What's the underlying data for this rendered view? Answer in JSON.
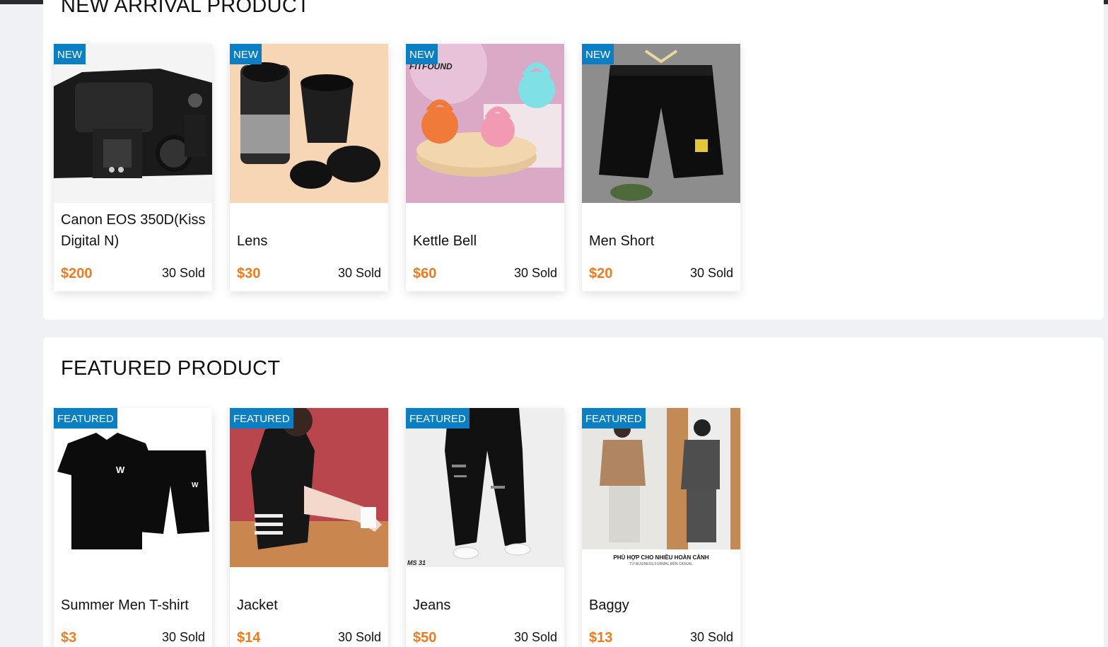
{
  "new_arrival": {
    "title": "NEW ARRIVAL PRODUCT",
    "badge": "NEW",
    "products": [
      {
        "name": "Canon EOS 350D(Kiss Digital N)",
        "price": "$200",
        "sold": "30 Sold",
        "icon": "camera-image"
      },
      {
        "name": "Lens",
        "price": "$30",
        "sold": "30 Sold",
        "icon": "lens-image"
      },
      {
        "name": "Kettle Bell",
        "price": "$60",
        "sold": "30 Sold",
        "icon": "kettlebell-image"
      },
      {
        "name": "Men Short",
        "price": "$20",
        "sold": "30 Sold",
        "icon": "shorts-image"
      }
    ]
  },
  "featured": {
    "title": "FEATURED PRODUCT",
    "badge": "FEATURED",
    "products": [
      {
        "name": "Summer Men T-shirt",
        "price": "$3",
        "sold": "30 Sold",
        "icon": "tshirt-set-image"
      },
      {
        "name": "Jacket",
        "price": "$14",
        "sold": "30 Sold",
        "icon": "jacket-image"
      },
      {
        "name": "Jeans",
        "price": "$50",
        "sold": "30 Sold",
        "icon": "jeans-image"
      },
      {
        "name": "Baggy",
        "price": "$13",
        "sold": "30 Sold",
        "icon": "baggy-image"
      }
    ]
  },
  "image_texts": {
    "kettlebell_brand": "FITFOUND",
    "jeans_caption": "MS 31",
    "baggy_caption": "PHÙ HỢP CHO NHIỀU HOÀN CẢNH",
    "baggy_subcaption": "TỪ BUSINESS FORMAL ĐẾN CASUAL"
  },
  "colors": {
    "badge": "#0b7fc4",
    "price": "#f07a1e",
    "background": "#f0f1f5"
  }
}
